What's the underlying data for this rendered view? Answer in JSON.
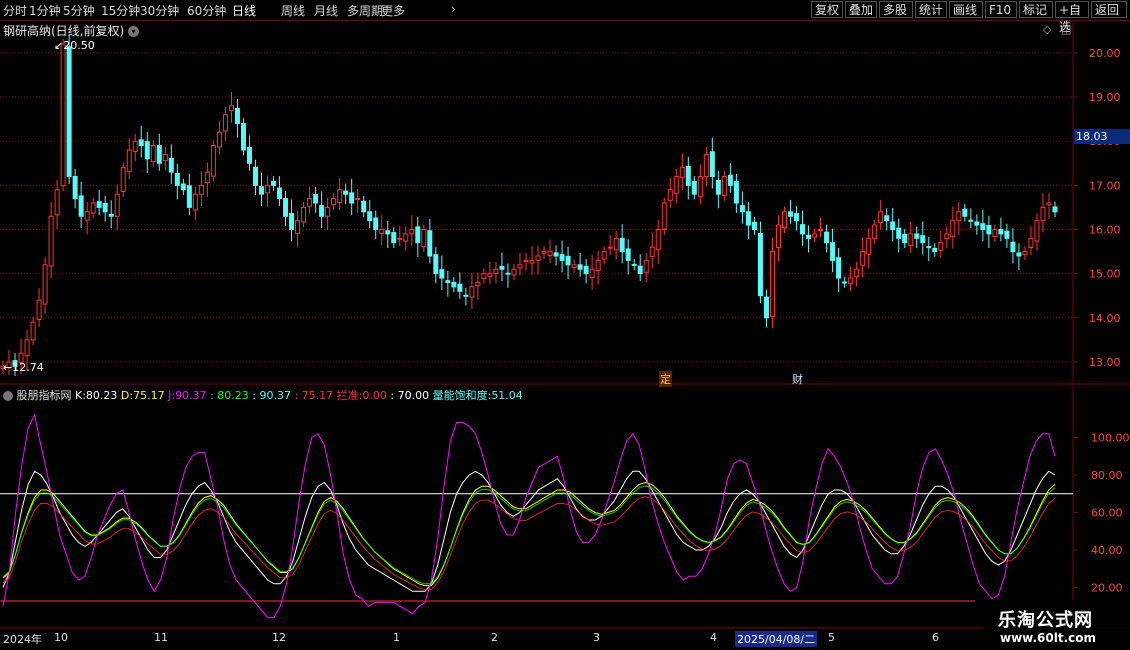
{
  "toolbar": {
    "periods": [
      "分时",
      "1分钟",
      "5分钟",
      "15分钟",
      "30分钟",
      "60分钟",
      "日线",
      "周线",
      "月线",
      "多周期",
      "更多"
    ],
    "active_period": "日线",
    "buttons": [
      "复权",
      "叠加",
      "多股",
      "统计",
      "画线",
      "F10",
      "标记",
      "+自选",
      "返回"
    ]
  },
  "main_panel": {
    "title": "钢研高纳(日线,前复权)",
    "high_label": "20.50",
    "low_label": "12.74",
    "current_price": "18.03",
    "markers": [
      "定",
      "财"
    ]
  },
  "indicator_panel": {
    "name": "股朋指标网",
    "k_label": "K:",
    "k_value": "80.23",
    "d_label": "D:",
    "d_value": "75.17",
    "j_label": "J:",
    "j_value": "90.37",
    "v1": ": 80.23",
    "v2": ": 90.37",
    "v3": ": 75.17",
    "lanjie_label": "拦准:",
    "lanjie_value": "0.00",
    "v4": ": 70.00",
    "sat_label": "量能饱和度:",
    "sat_value": "51.04"
  },
  "time_axis": {
    "labels": [
      "2024年",
      "10",
      "11",
      "12",
      "1",
      "2",
      "3",
      "4",
      "2025/04/08/二",
      "5",
      "6"
    ]
  },
  "watermark": {
    "line1": "乐淘公式网",
    "line2": "www.60lt.com"
  },
  "colors": {
    "up": "#ff3232",
    "down": "#54fcfc",
    "k": "#ffffff",
    "d": "#ffff00",
    "j": "#ff00ff",
    "grid": "#7a0000"
  },
  "chart_data": {
    "type": "candlestick",
    "price_axis": {
      "ticks": [
        13,
        14,
        15,
        16,
        17,
        18,
        19,
        20
      ],
      "range": [
        12.5,
        20.7
      ]
    },
    "indicator_axis": {
      "ticks": [
        20,
        40,
        60,
        80,
        100
      ],
      "range": [
        0,
        120
      ],
      "reference_lines": [
        70,
        0
      ]
    },
    "series": [
      {
        "name": "K",
        "values": [
          20,
          28,
          45,
          62,
          75,
          82,
          80,
          75,
          68,
          60,
          54,
          48,
          44,
          42,
          44,
          48,
          52,
          56,
          60,
          62,
          58,
          52,
          46,
          40,
          36,
          36,
          40,
          48,
          56,
          64,
          70,
          74,
          76,
          72,
          66,
          58,
          50,
          44,
          40,
          36,
          32,
          28,
          24,
          22,
          22,
          26,
          34,
          46,
          58,
          68,
          74,
          76,
          72,
          64,
          54,
          46,
          40,
          36,
          32,
          30,
          28,
          26,
          24,
          22,
          20,
          18,
          18,
          18,
          22,
          32,
          46,
          60,
          70,
          76,
          80,
          82,
          80,
          76,
          70,
          64,
          60,
          58,
          60,
          64,
          68,
          72,
          74,
          76,
          78,
          74,
          68,
          62,
          58,
          56,
          56,
          58,
          62,
          66,
          72,
          78,
          82,
          82,
          78,
          72,
          66,
          60,
          54,
          48,
          44,
          42,
          40,
          40,
          42,
          46,
          52,
          60,
          66,
          70,
          72,
          70,
          66,
          60,
          54,
          48,
          42,
          38,
          36,
          40,
          48,
          56,
          64,
          70,
          72,
          72,
          70,
          66,
          60,
          54,
          48,
          44,
          40,
          38,
          38,
          42,
          48,
          56,
          64,
          70,
          74,
          74,
          72,
          68,
          62,
          56,
          50,
          44,
          38,
          34,
          32,
          34,
          40,
          48,
          56,
          64,
          72,
          78,
          82,
          80
        ]
      },
      {
        "name": "D",
        "values": [
          25,
          28,
          38,
          50,
          60,
          68,
          72,
          72,
          70,
          66,
          62,
          58,
          54,
          50,
          48,
          48,
          50,
          52,
          55,
          57,
          57,
          55,
          52,
          48,
          45,
          42,
          42,
          44,
          48,
          54,
          60,
          65,
          68,
          69,
          67,
          64,
          59,
          54,
          50,
          46,
          42,
          38,
          34,
          31,
          28,
          28,
          30,
          36,
          44,
          52,
          60,
          66,
          68,
          66,
          62,
          57,
          52,
          47,
          43,
          39,
          36,
          33,
          30,
          28,
          26,
          24,
          22,
          21,
          21,
          25,
          32,
          41,
          51,
          60,
          67,
          72,
          74,
          74,
          72,
          69,
          66,
          63,
          62,
          62,
          64,
          66,
          68,
          70,
          72,
          72,
          71,
          68,
          65,
          62,
          60,
          59,
          60,
          61,
          64,
          68,
          72,
          75,
          76,
          75,
          72,
          68,
          63,
          58,
          54,
          50,
          47,
          45,
          44,
          45,
          47,
          51,
          56,
          61,
          65,
          67,
          66,
          64,
          61,
          57,
          52,
          48,
          44,
          43,
          44,
          48,
          53,
          58,
          63,
          66,
          67,
          66,
          64,
          61,
          57,
          53,
          49,
          46,
          44,
          44,
          46,
          49,
          54,
          59,
          64,
          67,
          68,
          67,
          65,
          62,
          58,
          53,
          48,
          44,
          40,
          38,
          38,
          41,
          46,
          52,
          59,
          66,
          72,
          75
        ]
      },
      {
        "name": "J",
        "values": [
          10,
          28,
          60,
          86,
          105,
          112,
          96,
          81,
          64,
          48,
          38,
          28,
          24,
          26,
          36,
          48,
          56,
          64,
          70,
          72,
          60,
          46,
          34,
          24,
          18,
          24,
          36,
          56,
          72,
          84,
          90,
          92,
          92,
          78,
          64,
          46,
          32,
          24,
          20,
          16,
          12,
          8,
          4,
          4,
          10,
          22,
          42,
          66,
          86,
          100,
          102,
          96,
          80,
          60,
          38,
          24,
          16,
          14,
          10,
          12,
          12,
          12,
          12,
          10,
          8,
          6,
          10,
          12,
          24,
          46,
          74,
          98,
          108,
          108,
          106,
          102,
          92,
          80,
          66,
          54,
          48,
          48,
          56,
          68,
          76,
          84,
          86,
          88,
          90,
          78,
          62,
          50,
          44,
          44,
          48,
          56,
          66,
          76,
          88,
          98,
          102,
          96,
          82,
          66,
          54,
          44,
          36,
          28,
          24,
          26,
          26,
          30,
          38,
          48,
          62,
          78,
          86,
          88,
          86,
          76,
          66,
          52,
          40,
          30,
          22,
          18,
          20,
          34,
          56,
          72,
          86,
          94,
          90,
          84,
          76,
          66,
          52,
          40,
          30,
          26,
          22,
          22,
          26,
          38,
          52,
          70,
          84,
          92,
          94,
          88,
          80,
          70,
          56,
          44,
          32,
          22,
          18,
          14,
          16,
          26,
          44,
          62,
          76,
          90,
          98,
          102,
          102,
          90
        ]
      }
    ]
  }
}
